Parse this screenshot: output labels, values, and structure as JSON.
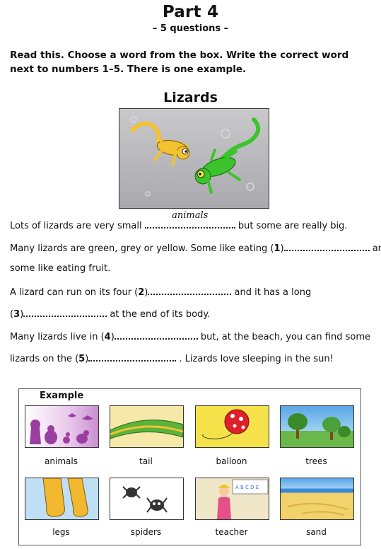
{
  "header": {
    "title": "Part 4",
    "subtitle": "– 5 questions –"
  },
  "instructions": "Read this. Choose a word from the box. Write the correct word next to numbers 1–5. There is one example.",
  "story": {
    "title": "Lizards",
    "line1": {
      "before": "Lots of lizards are very small ",
      "example_answer": "animals",
      "after": " but some are really big."
    },
    "line2": {
      "before": "Many lizards are green, grey or yellow. Some like eating (",
      "num": "1",
      "close": ")",
      "after": " and"
    },
    "line3": {
      "text": "some like eating fruit."
    },
    "line4": {
      "before": "A lizard can run on its four (",
      "num": "2",
      "close": ")",
      "after": " and it has a long"
    },
    "line5": {
      "before": "(",
      "num": "3",
      "close": ")",
      "after": " at the end of its body."
    },
    "line6": {
      "before": "Many lizards live in (",
      "num": "4",
      "close": ")",
      "after": " but, at the beach, you can find some"
    },
    "line7": {
      "before": "lizards on the (",
      "num": "5",
      "close": ")",
      "after": " . Lizards love sleeping in the sun!"
    }
  },
  "word_box": {
    "example_label": "Example",
    "words": [
      "animals",
      "tail",
      "balloon",
      "trees",
      "legs",
      "spiders",
      "teacher",
      "sand"
    ],
    "teacher_board_letters": "A B C D E"
  },
  "colors": {
    "lizard_yellow": "#f2c230",
    "lizard_green": "#3cc42c",
    "animals_purple": "#9a3fa0",
    "balloon_red": "#e0202a",
    "sand": "#f2d26a",
    "sky": "#5aa6e8"
  }
}
